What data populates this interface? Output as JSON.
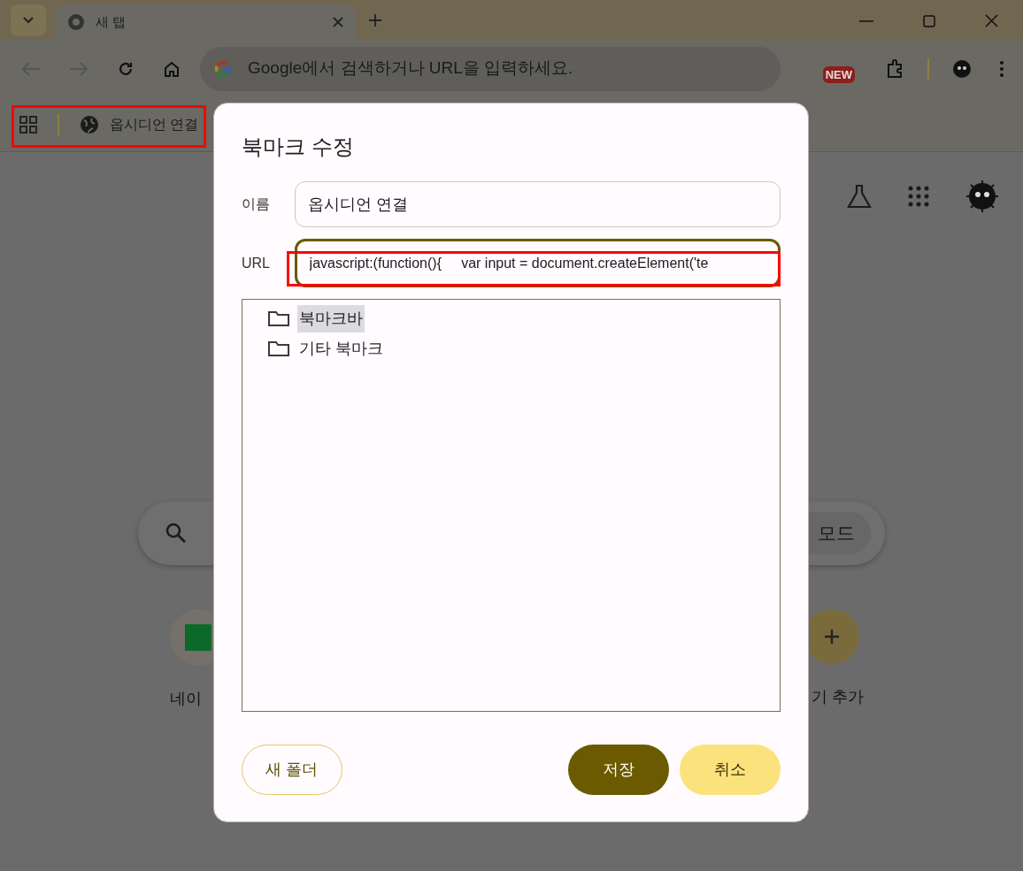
{
  "browser": {
    "tabs": [
      {
        "title": "새 탭",
        "selected": true
      }
    ],
    "navigation": {
      "back_disabled": true,
      "forward_disabled": true
    },
    "omnibox": {
      "placeholder": "Google에서 검색하거나 URL을 입력하세요."
    },
    "toolbar_badge": "NEW",
    "bookmarks": [
      {
        "title": "옵시디언 연결"
      }
    ]
  },
  "page": {
    "search_mode_button": "모드",
    "shortcuts": [
      {
        "label": "네이"
      },
      {
        "label": "기 추가"
      }
    ]
  },
  "dialog": {
    "title": "북마크 수정",
    "name_label": "이름",
    "name_value": "옵시디언 연결",
    "url_label": "URL",
    "url_value": "javascript:(function(){     var input = document.createElement('te",
    "url_focused": true,
    "folders": [
      {
        "name": "북마크바",
        "selected": true
      },
      {
        "name": "기타 북마크",
        "selected": false
      }
    ],
    "buttons": {
      "new_folder": "새 폴더",
      "save": "저장",
      "cancel": "취소"
    }
  }
}
